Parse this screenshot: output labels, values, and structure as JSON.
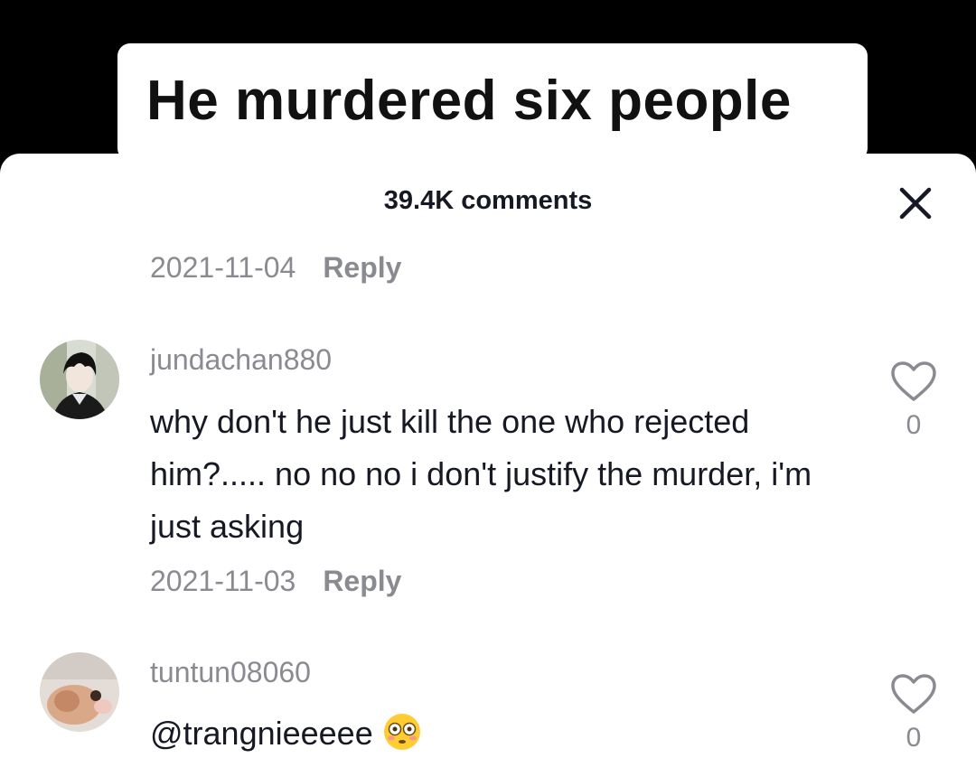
{
  "video": {
    "caption": "He murdered six people"
  },
  "sheet": {
    "title": "39.4K comments",
    "close_icon": "close-icon"
  },
  "previous_comment": {
    "date": "2021-11-04",
    "reply_label": "Reply"
  },
  "comments": [
    {
      "username": "jundachan880",
      "text": "why don't he just kill the one who rejected him?..... no no no i don't justify the murder, i'm just asking",
      "date": "2021-11-03",
      "reply_label": "Reply",
      "likes": "0",
      "avatar_icon": "anime-character-avatar"
    },
    {
      "username": "tuntun08060",
      "text": "@trangnieeeee",
      "emoji": "flushed-face-emoji",
      "likes": "0",
      "avatar_icon": "hamster-photo-avatar"
    }
  ],
  "colors": {
    "primary_text": "#161823",
    "secondary_text": "#8a8b91",
    "sheet_bg": "#ffffff",
    "video_bg": "#000000"
  }
}
